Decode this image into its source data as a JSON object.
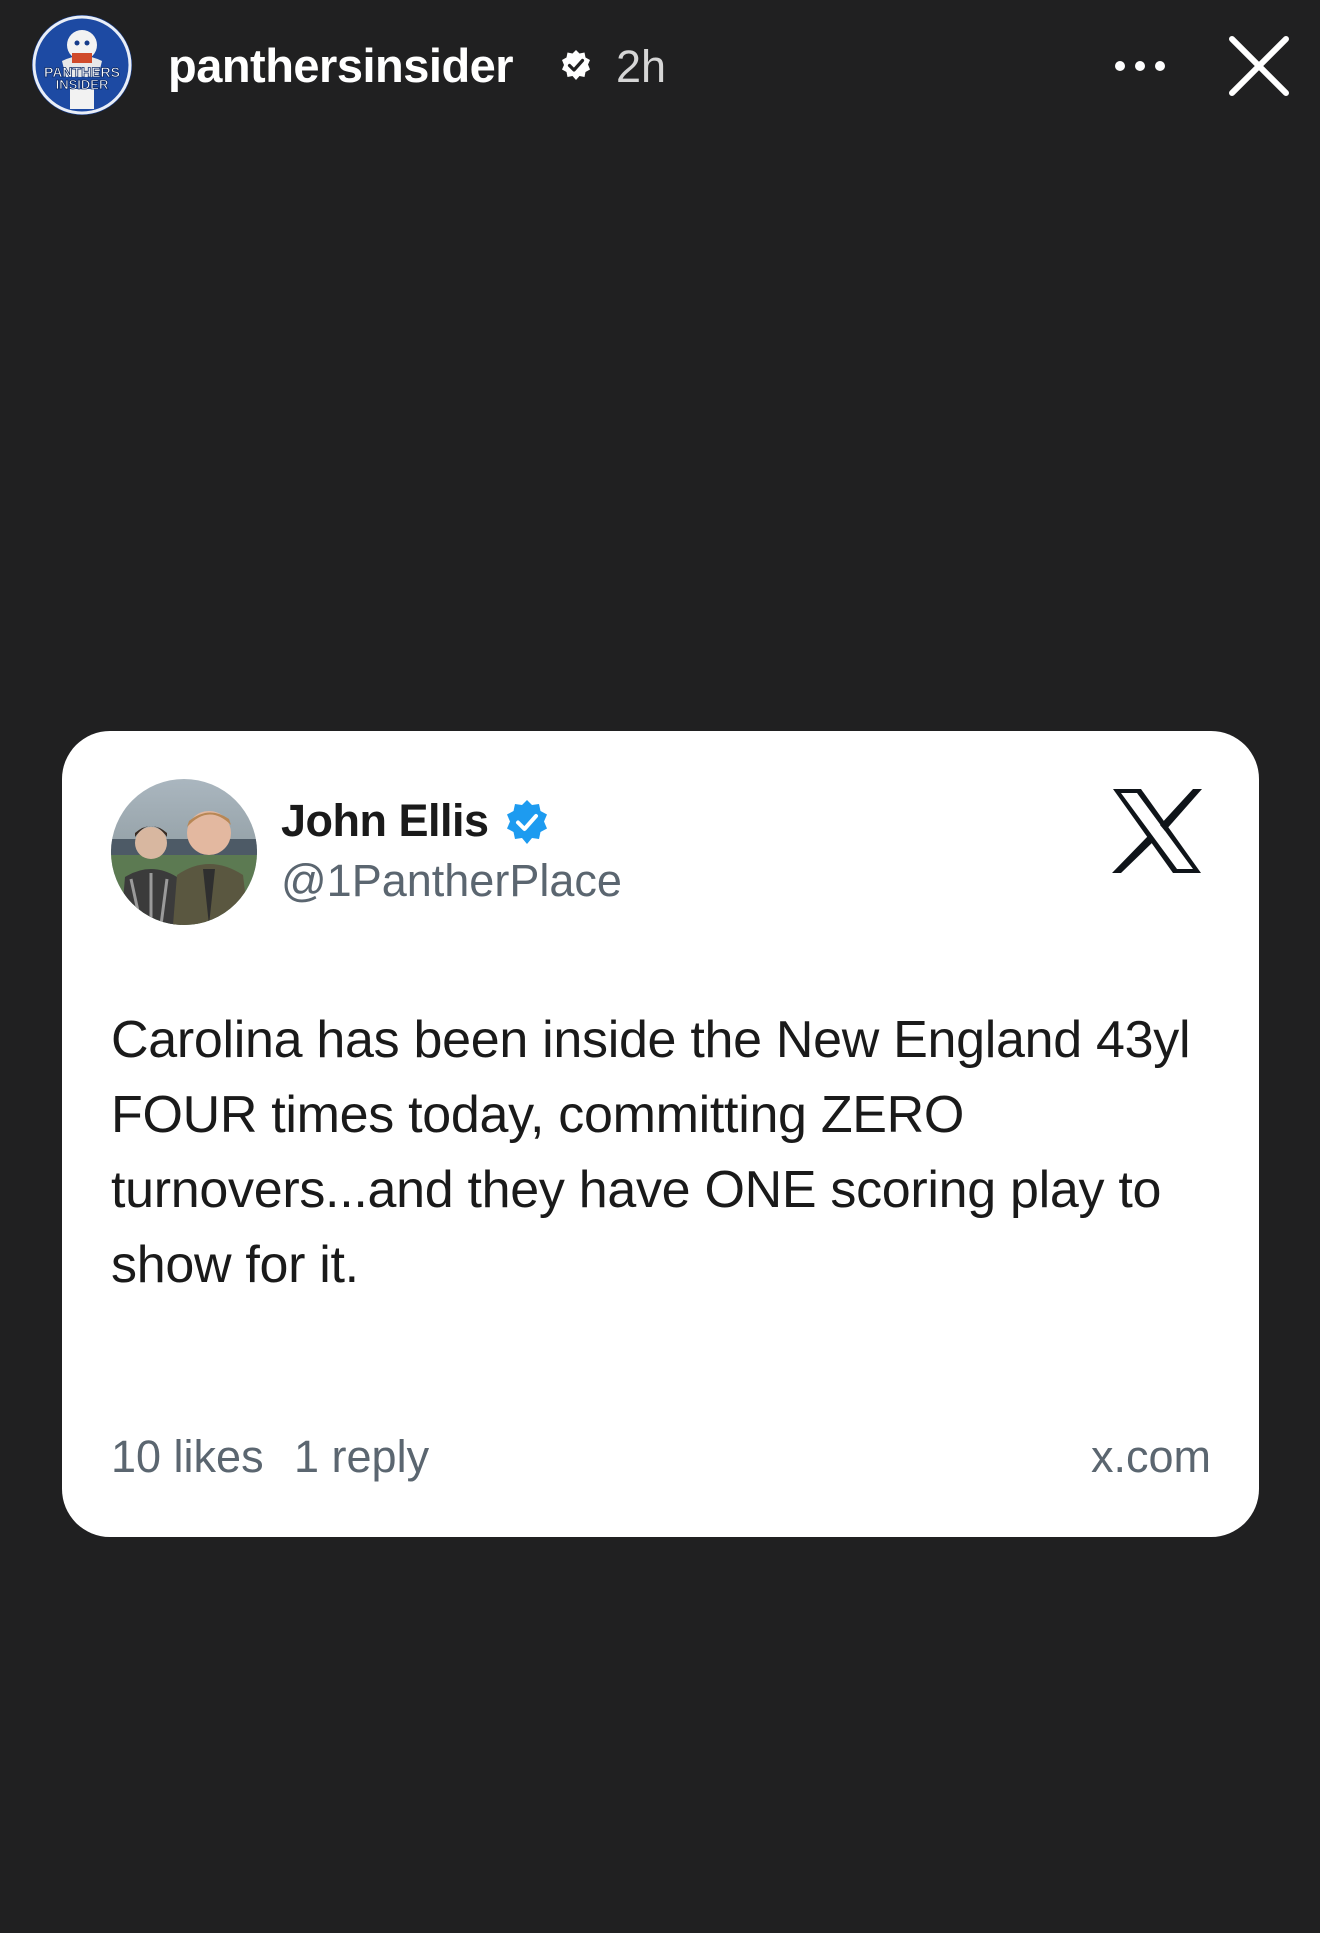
{
  "story": {
    "username": "panthersinsider",
    "timestamp": "2h",
    "avatar_icon": "panthers-insider-logo",
    "logo_text_line1": "PANTHERS",
    "logo_text_line2": "INSIDER"
  },
  "tweet": {
    "author_name": "John Ellis",
    "author_handle": "@1PantherPlace",
    "text": "Carolina has been inside the New England 43yl FOUR times today, committing ZERO turnovers...and they have ONE scoring play to show for it.",
    "likes": "10 likes",
    "replies": "1 reply",
    "domain": "x.com"
  },
  "colors": {
    "background": "#202021",
    "card": "#ffffff",
    "verified_blue": "#1d9bf0",
    "muted_text": "#5b6670"
  }
}
